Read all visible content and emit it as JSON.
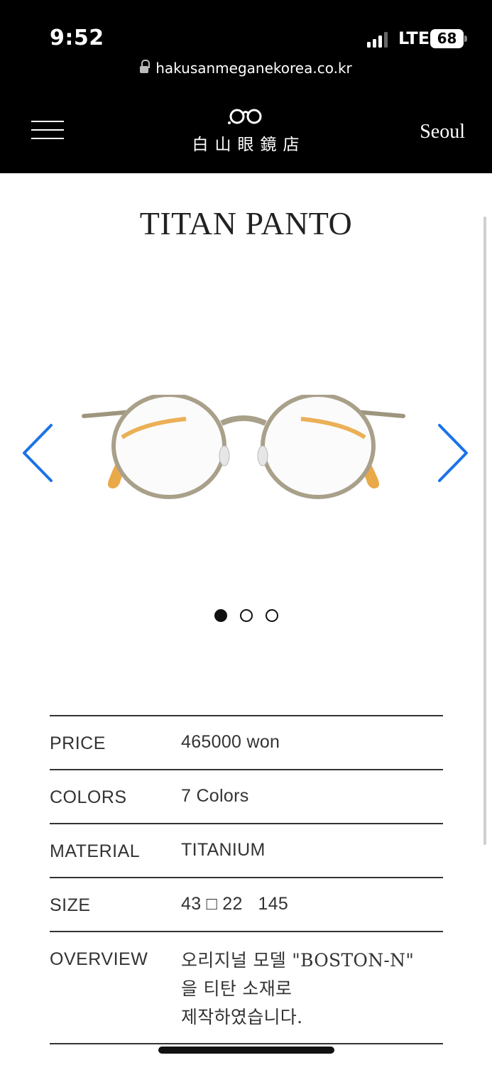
{
  "status_bar": {
    "time": "9:52",
    "network": "LTE",
    "battery": "68",
    "signal_bars_filled": 3
  },
  "browser": {
    "url": "hakusanmeganekorea.co.kr",
    "lock_icon": "lock-icon"
  },
  "site_header": {
    "menu_icon": "hamburger-menu-icon",
    "logo_icon": "glasses-logo-icon",
    "logo_text": "白山眼鏡店",
    "city": "Seoul"
  },
  "product": {
    "title": "TITAN PANTO",
    "carousel": {
      "prev_icon": "chevron-left-icon",
      "next_icon": "chevron-right-icon",
      "image": "round-titanium-eyeglasses-image",
      "slide_count": 3,
      "active_slide": 1
    },
    "specs": [
      {
        "label": "PRICE",
        "value": "465000 won"
      },
      {
        "label": "COLORS",
        "value": "7 Colors"
      },
      {
        "label": "MATERIAL",
        "value": "TITANIUM"
      },
      {
        "label": "SIZE",
        "value": "43 □ 22   145"
      }
    ],
    "overview": {
      "label": "OVERVIEW",
      "lines": [
        "오리지널 모델 \"BOSTON-N\"",
        "을 티탄 소재로",
        "제작하였습니다."
      ]
    }
  },
  "colors": {
    "header_bg": "#000000",
    "accent_arrow": "#1a73e8",
    "frame_metal": "#a9a08a",
    "temple_amber": "#e8a23a"
  }
}
